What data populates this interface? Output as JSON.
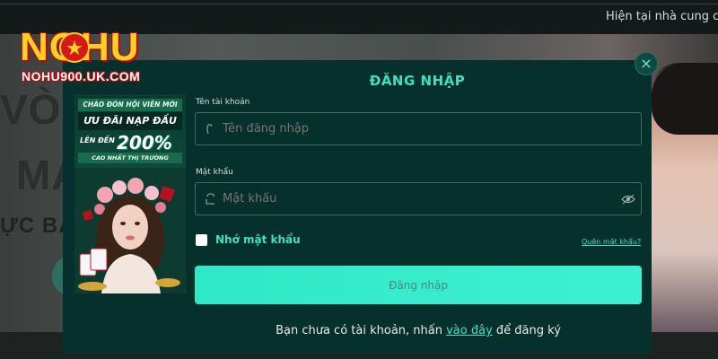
{
  "header": {
    "marquee_text": "Hiện tại nhà cung c"
  },
  "background": {
    "hero_line1": "VÒI",
    "hero_line2": "MA",
    "hero_line3": "ỰC BẤM"
  },
  "logo": {
    "brand": "NOHU",
    "domain": "NOHU900.UK.COM"
  },
  "promo": {
    "line1": "CHÀO ĐÓN HỘI VIÊN MỚI",
    "line2": "ƯU ĐÃI NẠP ĐẦU",
    "line3_prefix": "LÊN ĐẾN",
    "line3_value": "200%",
    "line4": "CAO NHẤT THỊ TRƯỜNG"
  },
  "login": {
    "title": "ĐĂNG NHẬP",
    "username_label": "Tên tài khoản",
    "username_placeholder": "Tên đăng nhập",
    "password_label": "Mật khẩu",
    "password_placeholder": "Mật khẩu",
    "remember_label": "Nhớ mật khẩu",
    "forgot_label": "Quên mật khẩu?",
    "submit_label": "Đăng nhập",
    "register_prefix": "Bạn chưa có tài khoản, nhấn ",
    "register_link": "vào đây",
    "register_suffix": " để đăng ký",
    "close_symbol": "×"
  },
  "colors": {
    "accent": "#3fe0c0",
    "modal_bg": "#06302c",
    "button": "#2fe8c6"
  },
  "icons": [
    "user-icon",
    "lock-icon",
    "eye-icon",
    "close-icon"
  ]
}
